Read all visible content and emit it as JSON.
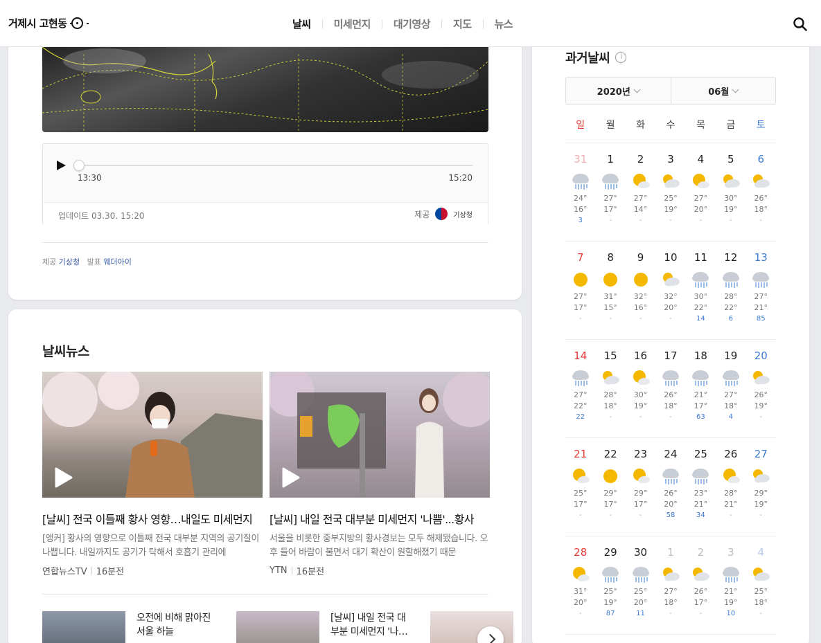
{
  "header": {
    "location": "거제시 고현동",
    "nav": [
      "날씨",
      "미세먼지",
      "대기영상",
      "지도",
      "뉴스"
    ],
    "active_nav": 0
  },
  "player": {
    "time_start": "13:30",
    "time_end": "15:20",
    "progress": 0,
    "update": "업데이트 03.30. 15:20",
    "provider_label": "제공",
    "provider_name": "기상청"
  },
  "source": {
    "provide_label": "제공",
    "provide_name": "기상청",
    "announce_label": "발표",
    "announce_name": "웨더아이"
  },
  "news": {
    "title": "날씨뉴스",
    "items": [
      {
        "headline": "[날씨] 전국 이틀째 황사 영향…내일도 미세먼지",
        "summary": "[앵커] 황사의 영향으로 이틀째 전국 대부분 지역의 공기질이 나쁩니다. 내일까지도 공기가 탁해서 호흡기 관리에",
        "source": "연합뉴스TV",
        "time": "16분전"
      },
      {
        "headline": "[날씨] 내일 전국 대부분 미세먼지 '나쁨'...황사",
        "summary": "서울을 비롯한 중부지방의 황사경보는 모두 해제됐습니다. 오후 들어 바람이 불면서 대기 확산이 원할해졌기 때문",
        "source": "YTN",
        "time": "16분전"
      }
    ],
    "mini": [
      {
        "text": "오전에 비해 맑아진 서울 하늘"
      },
      {
        "text": "[날씨] 내일 전국 대부분 미세먼지 '나…"
      },
      {
        "text": ""
      }
    ]
  },
  "past": {
    "title": "과거날씨",
    "info": "i",
    "year": "2020년",
    "month": "06월",
    "weekdays": [
      "일",
      "월",
      "화",
      "수",
      "목",
      "금",
      "토"
    ],
    "weeks": [
      [
        {
          "d": "31",
          "out": true,
          "icon": "rain",
          "hi": "24°",
          "lo": "16°",
          "rain": "3"
        },
        {
          "d": "1",
          "icon": "rain",
          "hi": "27°",
          "lo": "17°",
          "rain": "-"
        },
        {
          "d": "2",
          "icon": "partly-sunny",
          "hi": "27°",
          "lo": "14°",
          "rain": "-"
        },
        {
          "d": "3",
          "icon": "partly-cloudy",
          "hi": "25°",
          "lo": "19°",
          "rain": "-"
        },
        {
          "d": "4",
          "icon": "partly-sunny",
          "hi": "27°",
          "lo": "20°",
          "rain": "-"
        },
        {
          "d": "5",
          "icon": "partly-cloudy",
          "hi": "30°",
          "lo": "19°",
          "rain": "-"
        },
        {
          "d": "6",
          "icon": "partly-cloudy",
          "hi": "26°",
          "lo": "18°",
          "rain": "-"
        }
      ],
      [
        {
          "d": "7",
          "icon": "sunny",
          "hi": "27°",
          "lo": "17°",
          "rain": "-"
        },
        {
          "d": "8",
          "icon": "sunny",
          "hi": "31°",
          "lo": "15°",
          "rain": "-"
        },
        {
          "d": "9",
          "icon": "sunny",
          "hi": "32°",
          "lo": "16°",
          "rain": "-"
        },
        {
          "d": "10",
          "icon": "partly-cloudy",
          "hi": "32°",
          "lo": "20°",
          "rain": "-"
        },
        {
          "d": "11",
          "icon": "rain",
          "hi": "30°",
          "lo": "22°",
          "rain": "14"
        },
        {
          "d": "12",
          "icon": "rain",
          "hi": "28°",
          "lo": "22°",
          "rain": "6"
        },
        {
          "d": "13",
          "icon": "rain",
          "hi": "27°",
          "lo": "21°",
          "rain": "85"
        }
      ],
      [
        {
          "d": "14",
          "icon": "rain",
          "hi": "27°",
          "lo": "22°",
          "rain": "22"
        },
        {
          "d": "15",
          "icon": "partly-cloudy",
          "hi": "28°",
          "lo": "18°",
          "rain": "-"
        },
        {
          "d": "16",
          "icon": "partly-sunny",
          "hi": "30°",
          "lo": "19°",
          "rain": "-"
        },
        {
          "d": "17",
          "icon": "rain",
          "hi": "26°",
          "lo": "18°",
          "rain": "-"
        },
        {
          "d": "18",
          "icon": "rain",
          "hi": "21°",
          "lo": "17°",
          "rain": "63"
        },
        {
          "d": "19",
          "icon": "rain",
          "hi": "27°",
          "lo": "18°",
          "rain": "4"
        },
        {
          "d": "20",
          "icon": "partly-cloudy",
          "hi": "26°",
          "lo": "19°",
          "rain": "-"
        }
      ],
      [
        {
          "d": "21",
          "icon": "partly-sunny",
          "hi": "25°",
          "lo": "17°",
          "rain": "-"
        },
        {
          "d": "22",
          "icon": "sunny",
          "hi": "29°",
          "lo": "17°",
          "rain": "-"
        },
        {
          "d": "23",
          "icon": "partly-sunny",
          "hi": "29°",
          "lo": "17°",
          "rain": "-"
        },
        {
          "d": "24",
          "icon": "rain",
          "hi": "26°",
          "lo": "20°",
          "rain": "58"
        },
        {
          "d": "25",
          "icon": "rain",
          "hi": "23°",
          "lo": "21°",
          "rain": "34"
        },
        {
          "d": "26",
          "icon": "partly-sunny",
          "hi": "28°",
          "lo": "21°",
          "rain": "-"
        },
        {
          "d": "27",
          "icon": "partly-cloudy",
          "hi": "29°",
          "lo": "19°",
          "rain": "-"
        }
      ],
      [
        {
          "d": "28",
          "icon": "partly-sunny",
          "hi": "31°",
          "lo": "20°",
          "rain": "-"
        },
        {
          "d": "29",
          "icon": "rain",
          "hi": "25°",
          "lo": "19°",
          "rain": "87"
        },
        {
          "d": "30",
          "icon": "rain",
          "hi": "25°",
          "lo": "20°",
          "rain": "11"
        },
        {
          "d": "1",
          "out": true,
          "icon": "partly-cloudy",
          "hi": "27°",
          "lo": "18°",
          "rain": "-"
        },
        {
          "d": "2",
          "out": true,
          "icon": "partly-cloudy",
          "hi": "26°",
          "lo": "17°",
          "rain": "-"
        },
        {
          "d": "3",
          "out": true,
          "icon": "rain",
          "hi": "21°",
          "lo": "19°",
          "rain": "10"
        },
        {
          "d": "4",
          "out": true,
          "icon": "partly-cloudy",
          "hi": "25°",
          "lo": "18°",
          "rain": "-"
        }
      ]
    ]
  },
  "colors": {
    "sun": "#f5b800",
    "cloud": "#c9ced6",
    "rain_drop": "#5b8fd6",
    "sunday": "#e53935",
    "saturday": "#3d7bd6"
  }
}
